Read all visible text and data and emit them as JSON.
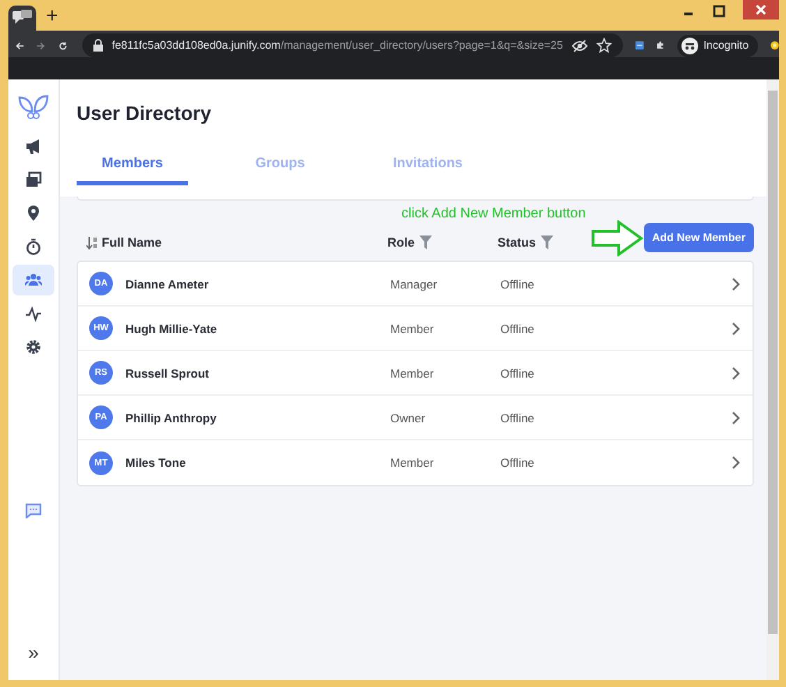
{
  "browser": {
    "url_host": "fe811fc5a03dd108ed0a.junify.com",
    "url_path": "/management/user_directory/users?page=1&q=&size=25",
    "profile": "Incognito",
    "new_tab": "+"
  },
  "sidebar": {
    "items": [
      {
        "kind": "megaphone",
        "selected": false
      },
      {
        "kind": "windows",
        "selected": false
      },
      {
        "kind": "pin",
        "selected": false
      },
      {
        "kind": "timer",
        "selected": false
      },
      {
        "kind": "people",
        "selected": true
      },
      {
        "kind": "pulse",
        "selected": false
      },
      {
        "kind": "gear",
        "selected": false
      }
    ],
    "expand": "»"
  },
  "page": {
    "title": "User Directory",
    "tabs": [
      {
        "label": "Members",
        "selected": true
      },
      {
        "label": "Groups",
        "selected": false
      },
      {
        "label": "Invitations",
        "selected": false
      }
    ],
    "annotation": "click Add New Member button",
    "add_button": "Add New Member",
    "columns": [
      {
        "label": "Full Name",
        "kind": "sort"
      },
      {
        "label": "Role",
        "kind": "filter"
      },
      {
        "label": "Status",
        "kind": "filter"
      }
    ],
    "rows": [
      {
        "initials": "DA",
        "name": "Dianne Ameter",
        "role": "Manager",
        "status": "Offline"
      },
      {
        "initials": "HW",
        "name": "Hugh Millie-Yate",
        "role": "Member",
        "status": "Offline"
      },
      {
        "initials": "RS",
        "name": "Russell Sprout",
        "role": "Member",
        "status": "Offline"
      },
      {
        "initials": "PA",
        "name": "Phillip Anthropy",
        "role": "Owner",
        "status": "Offline"
      },
      {
        "initials": "MT",
        "name": "Miles Tone",
        "role": "Member",
        "status": "Offline"
      }
    ]
  }
}
